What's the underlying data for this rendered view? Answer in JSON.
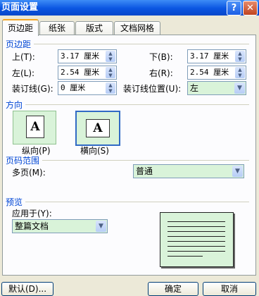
{
  "window": {
    "title": "页面设置",
    "help_label": "?",
    "close_label": "✕"
  },
  "tabs": [
    {
      "label": "页边距",
      "active": true
    },
    {
      "label": "纸张",
      "active": false
    },
    {
      "label": "版式",
      "active": false
    },
    {
      "label": "文档网格",
      "active": false
    }
  ],
  "margins": {
    "section_title": "页边距",
    "top": {
      "label": "上(T):",
      "value": "3.17 厘米"
    },
    "bottom": {
      "label": "下(B):",
      "value": "3.17 厘米"
    },
    "left": {
      "label": "左(L):",
      "value": "2.54 厘米"
    },
    "right": {
      "label": "右(R):",
      "value": "2.54 厘米"
    },
    "gutter": {
      "label": "装订线(G):",
      "value": "0 厘米"
    },
    "gutter_position": {
      "label": "装订线位置(U):",
      "value": "左"
    }
  },
  "orientation": {
    "section_title": "方向",
    "portrait": {
      "label": "纵向(P)",
      "glyph": "A"
    },
    "landscape": {
      "label": "横向(S)",
      "glyph": "A",
      "selected": true
    }
  },
  "pages": {
    "section_title": "页码范围",
    "multiple_label": "多页(M):",
    "multiple_value": "普通"
  },
  "preview": {
    "section_title": "预览",
    "apply_label": "应用于(Y):",
    "apply_value": "整篇文档"
  },
  "footer": {
    "default_label": "默认(D)...",
    "ok_label": "确定",
    "cancel_label": "取消"
  }
}
